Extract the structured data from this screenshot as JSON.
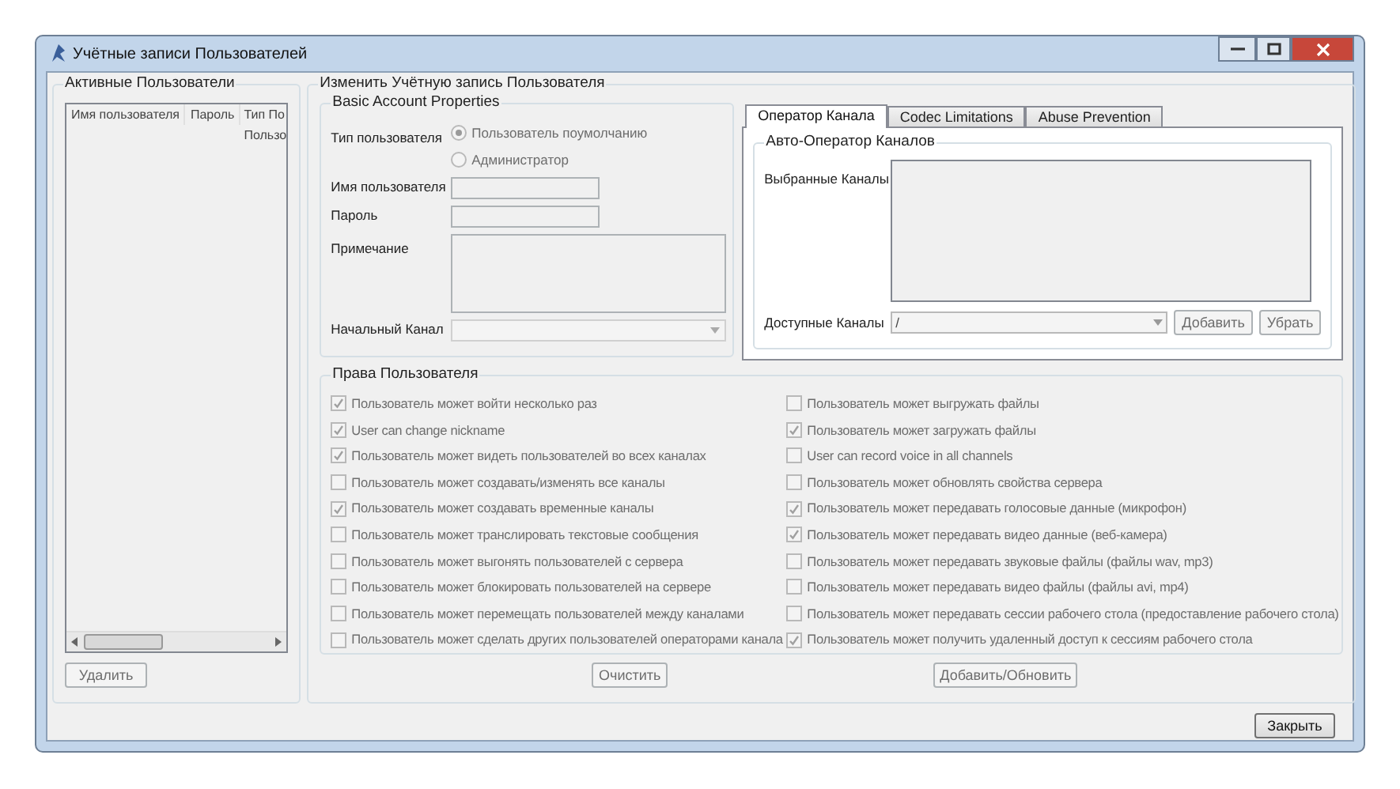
{
  "window": {
    "title": "Учётные записи Пользователей"
  },
  "users_panel": {
    "title": "Активные Пользователи",
    "columns": [
      "Имя пользователя",
      "Пароль",
      "Тип По"
    ],
    "rows": [
      {
        "cells": [
          "",
          "",
          "Пользо"
        ]
      }
    ],
    "delete_button": "Удалить"
  },
  "edit_panel": {
    "title": "Изменить Учётную запись Пользователя",
    "basic": {
      "title": "Basic Account Properties",
      "type_label": "Тип пользователя",
      "radios": [
        {
          "label": "Пользователь поумолчанию",
          "selected": true
        },
        {
          "label": "Администратор",
          "selected": false
        }
      ],
      "fields": [
        {
          "label": "Имя пользователя"
        },
        {
          "label": "Пароль"
        }
      ],
      "note_label": "Примечание",
      "channel_label": "Начальный Канал"
    },
    "tabs": [
      {
        "label": "Оператор Канала",
        "selected": true
      },
      {
        "label": "Codec Limitations",
        "selected": false
      },
      {
        "label": "Abuse Prevention",
        "selected": false
      }
    ],
    "auto_operator": {
      "title": "Авто-Оператор Каналов",
      "selected_label": "Выбранные Каналы",
      "available_label": "Доступные Каналы",
      "available_value": "/",
      "buttons": [
        "Добавить",
        "Убрать"
      ]
    },
    "rights": {
      "title": "Права Пользователя",
      "items": [
        {
          "label": "Пользователь может войти несколько раз",
          "checked": true
        },
        {
          "label": "User can change nickname",
          "checked": true
        },
        {
          "label": "Пользователь может видеть пользователей во всех каналах",
          "checked": true
        },
        {
          "label": "Пользователь может создавать/изменять все каналы",
          "checked": false
        },
        {
          "label": "Пользователь может создавать временные каналы",
          "checked": true
        },
        {
          "label": "Пользователь может транслировать текстовые сообщения",
          "checked": false
        },
        {
          "label": "Пользователь может выгонять пользователей с сервера",
          "checked": false
        },
        {
          "label": "Пользователь может блокировать пользователей на сервере",
          "checked": false
        },
        {
          "label": "Пользователь может перемещать пользователей между каналами",
          "checked": false
        },
        {
          "label": "Пользователь может сделать других пользователей операторами канала",
          "checked": false
        },
        {
          "label": "Пользователь может выгружать файлы",
          "checked": false
        },
        {
          "label": "Пользователь может загружать файлы",
          "checked": true
        },
        {
          "label": "User can record voice in all channels",
          "checked": false
        },
        {
          "label": "Пользователь может обновлять свойства сервера",
          "checked": false
        },
        {
          "label": "Пользователь может передавать голосовые данные (микрофон)",
          "checked": true
        },
        {
          "label": "Пользователь может передавать видео данные (веб-камера)",
          "checked": true
        },
        {
          "label": "Пользователь может передавать звуковые файлы (файлы wav, mp3)",
          "checked": false
        },
        {
          "label": "Пользователь может передавать видео файлы (файлы avi, mp4)",
          "checked": false
        },
        {
          "label": "Пользователь может передавать сессии рабочего стола (предоставление рабочего стола)",
          "checked": false
        },
        {
          "label": "Пользователь может получить  удаленный доступ к сессиям рабочего стола",
          "checked": true
        }
      ]
    },
    "buttons": [
      "Очистить",
      "Добавить/Обновить"
    ]
  },
  "close_button": "Закрыть"
}
